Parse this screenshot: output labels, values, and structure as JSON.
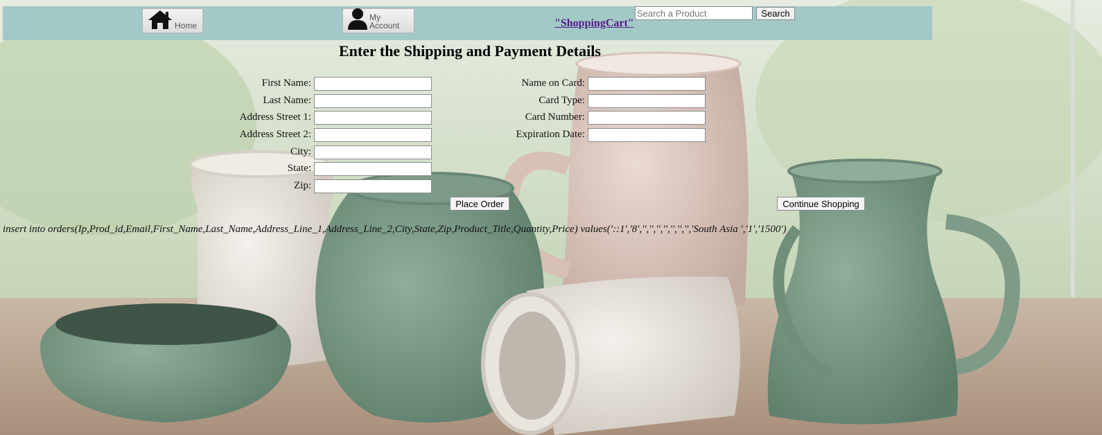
{
  "nav": {
    "home_label": "Home",
    "account_label": "My Account",
    "cart_link": "\"ShoppingCart\"",
    "search_placeholder": "Search a Product",
    "search_value": "",
    "search_button": "Search",
    "bar_color": "#a2c9c6",
    "link_color": "#551a8b"
  },
  "page": {
    "title": "Enter the Shipping and Payment Details"
  },
  "shipping": {
    "fields": [
      {
        "label": "First Name:",
        "value": ""
      },
      {
        "label": "Last Name:",
        "value": ""
      },
      {
        "label": "Address Street 1:",
        "value": ""
      },
      {
        "label": "Address Street 2:",
        "value": ""
      },
      {
        "label": "City:",
        "value": ""
      },
      {
        "label": "State:",
        "value": ""
      },
      {
        "label": "Zip:",
        "value": ""
      }
    ]
  },
  "payment": {
    "fields": [
      {
        "label": "Name on Card:",
        "value": ""
      },
      {
        "label": "Card Type:",
        "value": ""
      },
      {
        "label": "Card Number:",
        "value": ""
      },
      {
        "label": "Expiration Date:",
        "value": ""
      }
    ]
  },
  "actions": {
    "place_order": "Place Order",
    "continue_shopping": "Continue Shopping"
  },
  "debug": {
    "sql": "insert into orders(Ip,Prod_id,Email,First_Name,Last_Name,Address_Line_1,Address_Line_2,City,State,Zip,Product_Title,Quantity,Price) values('::1','8','','','','','','','','South Asia ','1','1500')"
  },
  "icons": {
    "home": "house-icon",
    "account": "user-silhouette-icon"
  }
}
